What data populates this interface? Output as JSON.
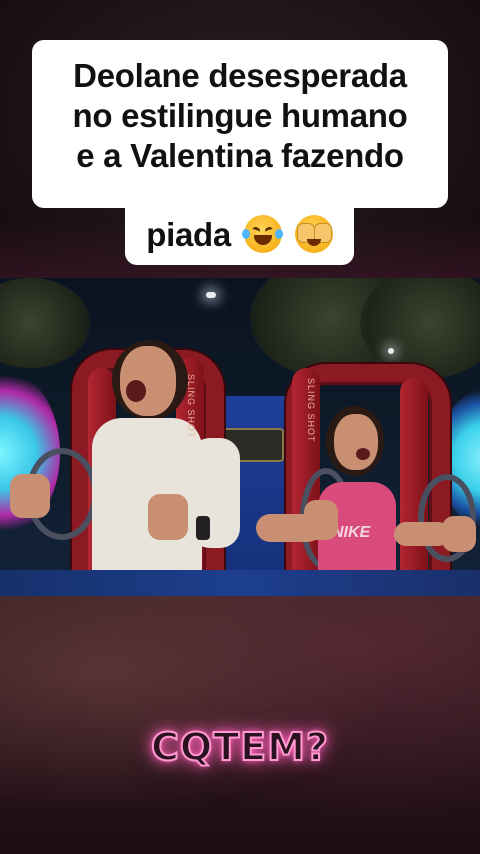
{
  "caption": {
    "line1": "Deolane desesperada",
    "line2": "no estilingue humano",
    "line3": "e a Valentina fazendo",
    "line4": "piada",
    "emojis": [
      "rolling-on-floor-laughing-icon",
      "face-with-hand-over-eyes-icon"
    ]
  },
  "photo": {
    "ride_text_left": "SLING SHOT",
    "ride_text_right": "SLING SHOT",
    "shirt_text": "NIKE"
  },
  "watermark": {
    "text": "CQTEM?",
    "glow_color": "#ff5fb8"
  },
  "colors": {
    "harness": "#8c1a22",
    "caption_bg": "#ffffff"
  }
}
